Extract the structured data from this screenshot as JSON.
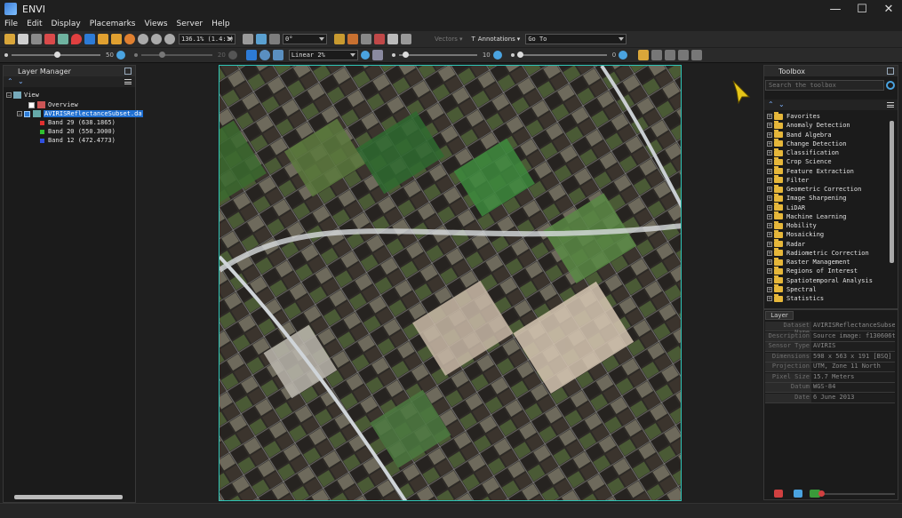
{
  "window": {
    "title": "ENVI",
    "controls": {
      "minimize": "—",
      "maximize": "☐",
      "close": "✕"
    }
  },
  "menu": [
    "File",
    "Edit",
    "Display",
    "Placemarks",
    "Views",
    "Server",
    "Help"
  ],
  "toolbar": {
    "zoom_combo": "136.1% (1.4:1)",
    "rotation_combo": "0°",
    "vectors_label": "Vectors",
    "annotations_label": "Annotations",
    "goto_combo": "Go To",
    "brightness_value": "50",
    "contrast_value": "20",
    "stretch_combo": "Linear 2%",
    "sharpen_value": "10",
    "transparency_value": "0"
  },
  "layer_manager": {
    "title": "Layer Manager",
    "view_label": "View",
    "overview_label": "Overview",
    "layer_name": "AVIRISReflectanceSubset.da",
    "bands": [
      {
        "label": "Band 29 (638.1865)",
        "color": "#e03030"
      },
      {
        "label": "Band 20 (550.3000)",
        "color": "#30c030"
      },
      {
        "label": "Band 12 (472.4773)",
        "color": "#3050e0"
      }
    ]
  },
  "toolbox": {
    "title": "Toolbox",
    "search_placeholder": "Search the toolbox",
    "items": [
      "Favorites",
      "Anomaly Detection",
      "Band Algebra",
      "Change Detection",
      "Classification",
      "Crop Science",
      "Feature Extraction",
      "Filter",
      "Geometric Correction",
      "Image Sharpening",
      "LiDAR",
      "Machine Learning",
      "Mobility",
      "Mosaicking",
      "Radar",
      "Radiometric Correction",
      "Raster Management",
      "Regions of Interest",
      "Spatiotemporal Analysis",
      "Spectral",
      "Statistics"
    ]
  },
  "layer_props": {
    "tab": "Layer",
    "rows": [
      {
        "key": "Dataset Name",
        "value": "AVIRISReflectanceSubset."
      },
      {
        "key": "Description",
        "value": "Source image: f130606t01"
      },
      {
        "key": "Sensor Type",
        "value": "AVIRIS"
      },
      {
        "key": "Dimensions",
        "value": "598 x 563 x 191 [BSQ] Fl"
      },
      {
        "key": "Projection",
        "value": "UTM, Zone 11 North"
      },
      {
        "key": "Pixel Size",
        "value": "15.7 Meters"
      },
      {
        "key": "Datum",
        "value": "WGS-84"
      },
      {
        "key": "Date",
        "value": "6 June 2013"
      }
    ]
  },
  "colors": {
    "accent": "#2ec4b6",
    "selection": "#1f6fd1",
    "cursor": "#e6c619"
  }
}
